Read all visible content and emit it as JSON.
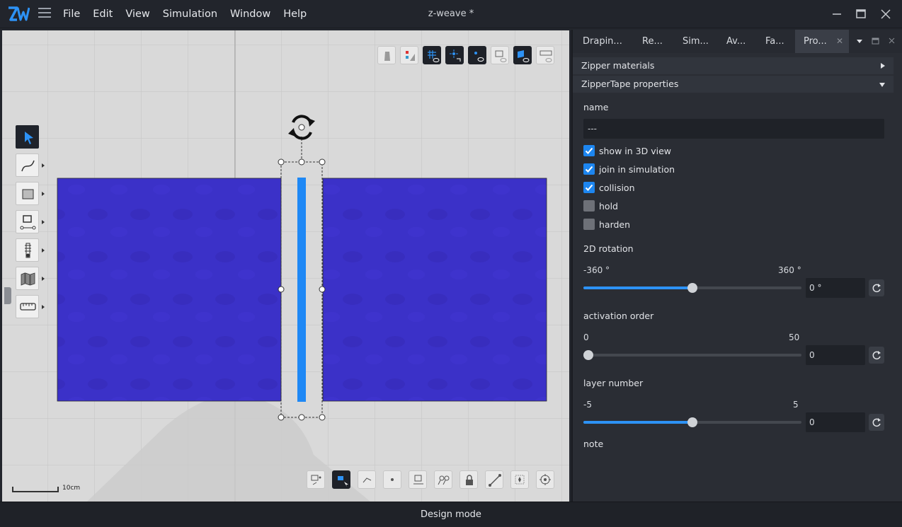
{
  "app": {
    "title": "z-weave *",
    "logo_text": "ZW"
  },
  "menu": [
    "File",
    "Edit",
    "View",
    "Simulation",
    "Window",
    "Help"
  ],
  "statusbar": {
    "mode": "Design mode"
  },
  "canvas": {
    "scale_label": "10cm",
    "fabric_color": "#3b31c8",
    "zipper_color": "#1e88f5"
  },
  "panel": {
    "tabs": [
      "Drapin...",
      "Re...",
      "Sim...",
      "Av...",
      "Fa...",
      "Pro..."
    ],
    "active_tab": "Pro...",
    "sections": {
      "zipper_materials": "Zipper materials",
      "zippertape_properties": "ZipperTape properties"
    },
    "name": {
      "label": "name",
      "value": "---"
    },
    "checkboxes": [
      {
        "label": "show in 3D view",
        "checked": true
      },
      {
        "label": "join in simulation",
        "checked": true
      },
      {
        "label": "collision",
        "checked": true
      },
      {
        "label": "hold",
        "checked": false
      },
      {
        "label": "harden",
        "checked": false
      }
    ],
    "rotation": {
      "label": "2D rotation",
      "min": "-360 °",
      "max": "360 °",
      "value": "0 °",
      "fraction": 0.5
    },
    "activation": {
      "label": "activation order",
      "min": "0",
      "max": "50",
      "value": "0",
      "fraction": 0.0
    },
    "layer": {
      "label": "layer number",
      "min": "-5",
      "max": "5",
      "value": "0",
      "fraction": 0.5
    },
    "note": {
      "label": "note"
    }
  },
  "colors": {
    "accent": "#1d86f0",
    "panel_bg": "#2a2d34",
    "canvas_bg": "#d9d9d9"
  }
}
